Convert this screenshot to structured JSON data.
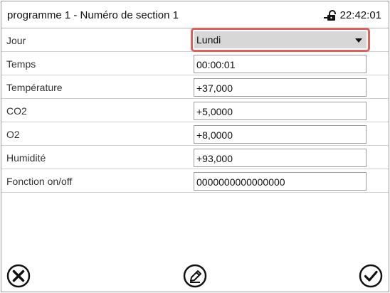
{
  "header": {
    "title": "programme 1 - Numéro de section 1",
    "time": "22:42:01",
    "lock_icon": "lock-icon"
  },
  "rows": [
    {
      "label": "Jour",
      "value": "Lundi",
      "type": "select"
    },
    {
      "label": "Temps",
      "value": "00:00:01"
    },
    {
      "label": "Température",
      "value": "+37,000"
    },
    {
      "label": "CO2",
      "value": "+5,0000"
    },
    {
      "label": "O2",
      "value": "+8,0000"
    },
    {
      "label": "Humidité",
      "value": "+93,000"
    },
    {
      "label": "Fonction on/off",
      "value": "0000000000000000"
    }
  ],
  "buttons": {
    "cancel_icon": "close-circle-icon",
    "edit_icon": "edit-pencil-icon",
    "confirm_icon": "check-circle-icon"
  },
  "colors": {
    "highlight": "#e0605d",
    "select_bg": "#d7d7d7"
  }
}
